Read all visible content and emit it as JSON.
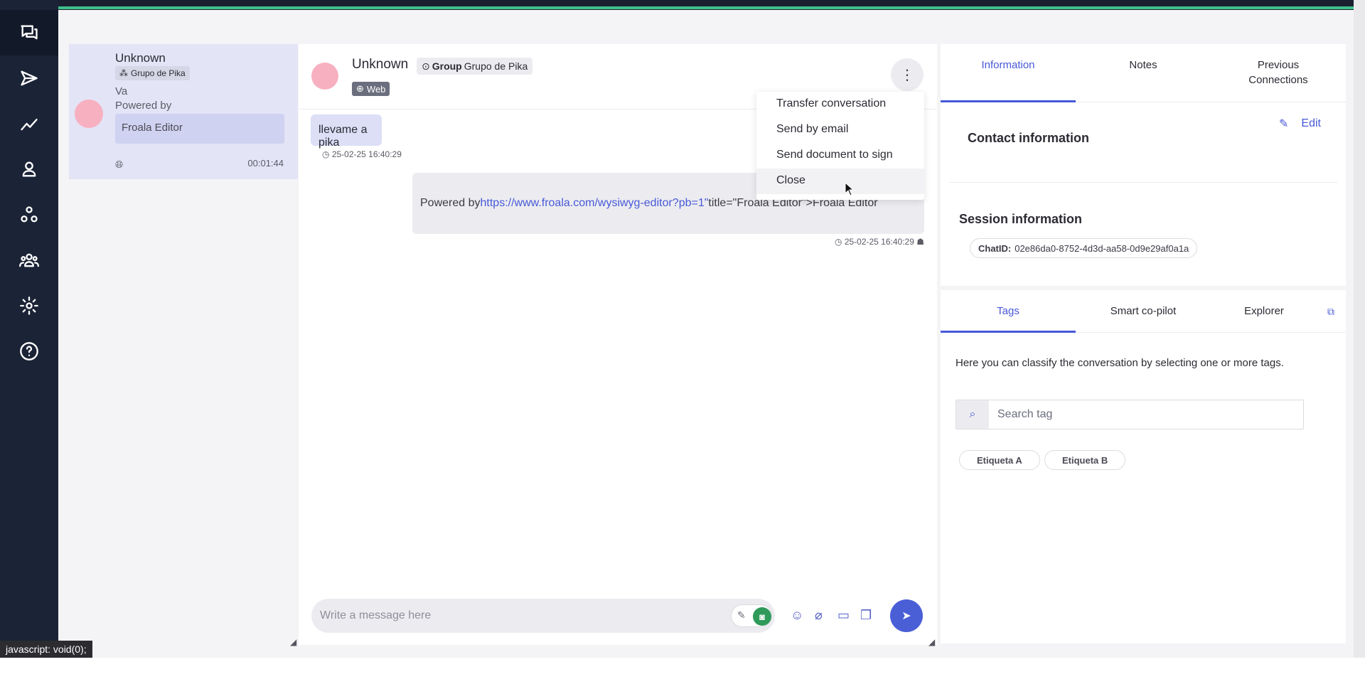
{
  "sidebar": {
    "items": [
      {
        "name": "conversations-icon",
        "active": true
      },
      {
        "name": "send-icon"
      },
      {
        "name": "analytics-icon"
      },
      {
        "name": "user-icon"
      },
      {
        "name": "groups-icon"
      },
      {
        "name": "team-icon"
      },
      {
        "name": "settings-icon"
      },
      {
        "name": "help-icon"
      }
    ]
  },
  "conversation_list": {
    "items": [
      {
        "name": "Unknown",
        "group": "Grupo de Pika",
        "line1": "Va",
        "line2": "Powered by",
        "box_text": "Froala Editor",
        "time": "00:01:44"
      }
    ]
  },
  "chat": {
    "contact_name": "Unknown",
    "group_label": "Group",
    "group_name": "Grupo de Pika",
    "channel": "Web",
    "messages": [
      {
        "direction": "in",
        "text": "llevame a pika",
        "timestamp": "25-02-25 16:40:29"
      },
      {
        "direction": "out",
        "prefix": "Powered by ",
        "link": "https://www.froala.com/wysiwyg-editor?pb=1\"",
        "suffix": " title=\"Froala Editor\">Froala Editor",
        "timestamp": "25-02-25 16:40:29"
      }
    ],
    "composer_placeholder": "Write a message here"
  },
  "menu": {
    "items": [
      "Transfer conversation",
      "Send by email",
      "Send document to sign",
      "Close"
    ]
  },
  "right_panel": {
    "tabs": [
      "Information",
      "Notes",
      "Previous Connections"
    ],
    "edit_label": "Edit",
    "contact_title": "Contact information",
    "session_title": "Session information",
    "chat_id_label": "ChatID:",
    "chat_id_value": "02e86da0-8752-4d3d-aa58-0d9e29af0a1a",
    "bottom_tabs": [
      "Tags",
      "Smart co-pilot",
      "Explorer"
    ],
    "tags_help": "Here you can classify the conversation by selecting one or more tags.",
    "tag_search_placeholder": "Search tag",
    "tags": [
      "Etiqueta A",
      "Etiqueta B"
    ]
  },
  "status_tooltip": "javascript: void(0);",
  "colors": {
    "accent": "#4758d8",
    "sidebar": "#1b2336",
    "avatar": "#f7b0c0",
    "bot_toggle": "#2f9a5a"
  }
}
